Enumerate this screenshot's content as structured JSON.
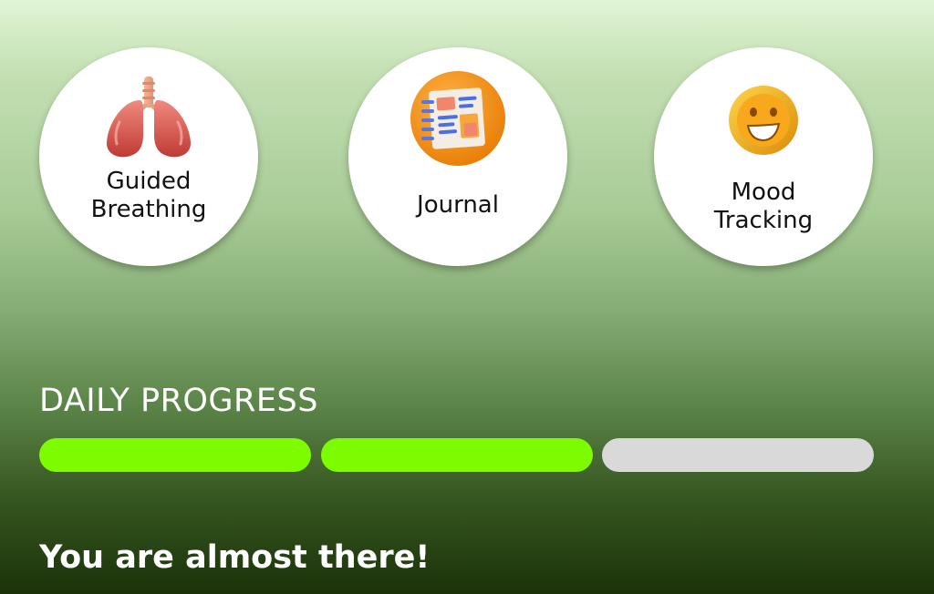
{
  "features": [
    {
      "label": "Guided\nBreathing",
      "icon": "lungs-icon"
    },
    {
      "label": "Journal",
      "icon": "journal-icon"
    },
    {
      "label": "Mood\nTracking",
      "icon": "smiley-face-icon"
    }
  ],
  "progress": {
    "title": "DAILY PROGRESS",
    "segments_total": 3,
    "segments_completed": 2,
    "completed_color": "#7dfc00",
    "remaining_color": "#d9d9d9"
  },
  "message": "You are almost there!",
  "colors": {
    "background_top": "#e1f5d6",
    "background_bottom": "#1b3209",
    "card": "#ffffff",
    "text_light": "#ffffff",
    "text_dark": "#111111"
  }
}
